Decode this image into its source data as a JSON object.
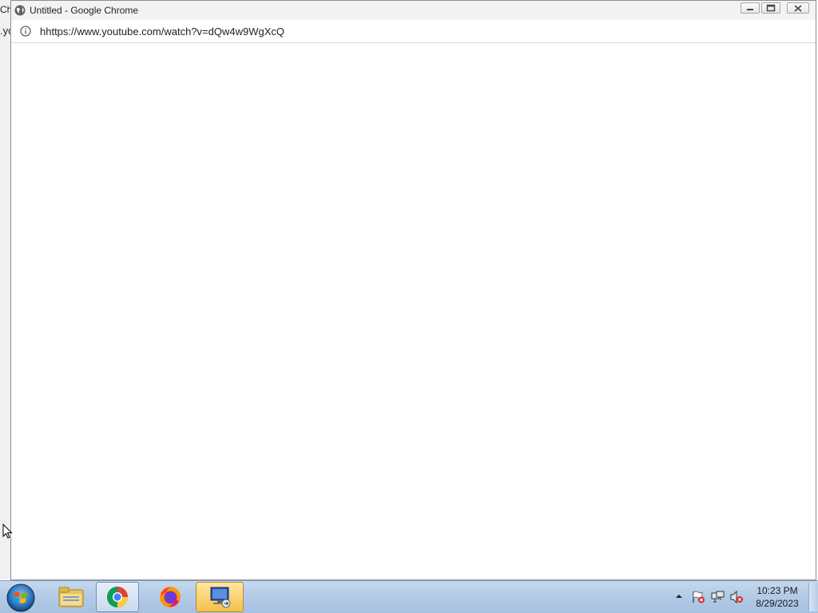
{
  "background_window": {
    "title_fragment": "Ch",
    "url_fragment": ".yo"
  },
  "window": {
    "title": "Untitled - Google Chrome",
    "title_icon": "globe-icon",
    "controls": {
      "minimize_icon": "minimize-icon",
      "maximize_icon": "maximize-icon",
      "close_icon": "close-icon"
    }
  },
  "address_bar": {
    "info_icon": "info-icon",
    "url": "hhttps://www.youtube.com/watch?v=dQw4w9WgXcQ"
  },
  "taskbar": {
    "start_icon": "windows-start-icon",
    "pinned": [
      {
        "name": "explorer",
        "icon": "folder-icon"
      },
      {
        "name": "chrome",
        "icon": "chrome-icon",
        "active": true
      },
      {
        "name": "firefox",
        "icon": "firefox-icon"
      },
      {
        "name": "remote",
        "icon": "remote-desktop-icon",
        "highlighted": true
      }
    ],
    "tray": {
      "expand_icon": "tray-expand-icon",
      "icons": [
        "action-center-flag-icon",
        "network-icon",
        "volume-muted-icon"
      ]
    },
    "clock": {
      "time": "10:23 PM",
      "date": "8/29/2023"
    }
  },
  "colors": {
    "taskbar": "#b3cbe6",
    "window_title_bar": "#f3f3f3",
    "remote_highlight": "#f5c04a"
  }
}
